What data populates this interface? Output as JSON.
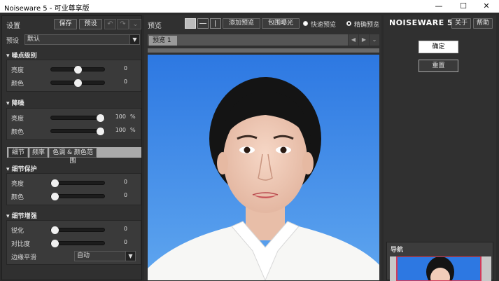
{
  "window": {
    "title": "Noiseware 5 - 可业尊享版",
    "minimize": "—",
    "maximize": "☐",
    "close": "✕"
  },
  "left": {
    "settings_title": "设置",
    "save_label": "保存",
    "preset_label": "预设",
    "preset_field_label": "预设",
    "preset_value": "默认",
    "noise_level": {
      "header": "噪点级别",
      "rows": [
        {
          "label": "亮度",
          "value": "0"
        },
        {
          "label": "颜色",
          "value": "0"
        }
      ]
    },
    "denoise": {
      "header": "降噪",
      "rows": [
        {
          "label": "亮度",
          "value": "100",
          "unit": "%"
        },
        {
          "label": "颜色",
          "value": "100",
          "unit": "%"
        }
      ]
    },
    "tabs": [
      "细节",
      "频率",
      "色调 & 颜色范围"
    ],
    "detail_protect": {
      "header": "细节保护",
      "rows": [
        {
          "label": "亮度",
          "value": "0"
        },
        {
          "label": "颜色",
          "value": "0"
        }
      ]
    },
    "detail_enhance": {
      "header": "细节增强",
      "rows": [
        {
          "label": "锐化",
          "value": "0"
        },
        {
          "label": "对比度",
          "value": "0"
        }
      ],
      "edge_smooth_label": "边缘平滑",
      "edge_smooth_value": "自动"
    },
    "slider_levels": {
      "noise_brightness": 0.5,
      "noise_color": 0.5,
      "denoise_brightness": 1.0,
      "denoise_color": 1.0,
      "protect_brightness": 0.0,
      "protect_color": 0.0,
      "enhance_sharpen": 0.0,
      "enhance_contrast": 0.0
    }
  },
  "center": {
    "preview_title": "预览",
    "add_preview_label": "添加预览",
    "bracket_label": "包围曝光",
    "fast_preview_label": "快速预览",
    "accurate_preview_label": "精确预览",
    "selected_mode": "精确预览",
    "preview_tab": "预览 1"
  },
  "right": {
    "logo": "NOISEWARE 5",
    "about_label": "关于",
    "help_label": "帮助",
    "ok_label": "确定",
    "reset_label": "重置",
    "navigator_label": "导航"
  },
  "colors": {
    "panel_bg": "#303030",
    "section_bg": "#3a3a3a",
    "photo_bg_top": "#2f7fe6",
    "photo_bg_bottom": "#63a8f0"
  }
}
